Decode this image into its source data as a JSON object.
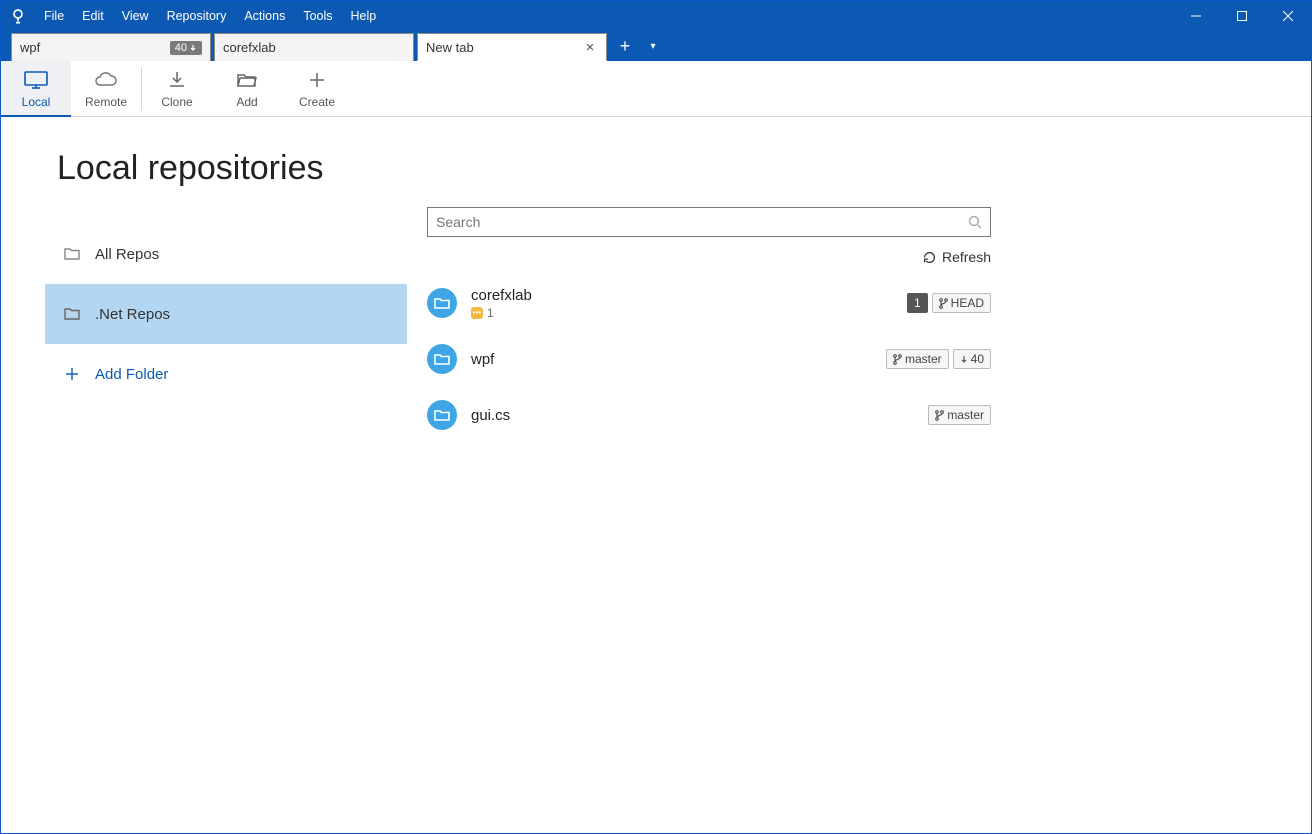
{
  "menu": {
    "items": [
      "File",
      "Edit",
      "View",
      "Repository",
      "Actions",
      "Tools",
      "Help"
    ]
  },
  "tabs": [
    {
      "title": "wpf",
      "badge": "40",
      "active": false,
      "closable": false
    },
    {
      "title": "corefxlab",
      "badge": null,
      "active": false,
      "closable": false
    },
    {
      "title": "New tab",
      "badge": null,
      "active": true,
      "closable": true
    }
  ],
  "toolbar": [
    {
      "label": "Local",
      "icon": "monitor",
      "selected": true
    },
    {
      "label": "Remote",
      "icon": "cloud",
      "selected": false
    },
    {
      "label": "Clone",
      "icon": "download",
      "selected": false
    },
    {
      "label": "Add",
      "icon": "folder-open",
      "selected": false
    },
    {
      "label": "Create",
      "icon": "plus",
      "selected": false
    }
  ],
  "page": {
    "title": "Local repositories"
  },
  "sidebar": {
    "items": [
      {
        "label": "All Repos",
        "icon": "folder",
        "selected": false
      },
      {
        "label": ".Net Repos",
        "icon": "folder",
        "selected": true
      }
    ],
    "add_folder": "Add Folder"
  },
  "search": {
    "placeholder": "Search"
  },
  "refresh": {
    "label": "Refresh"
  },
  "repos": [
    {
      "name": "corefxlab",
      "stash_count": "1",
      "count_badge": "1",
      "branch": "HEAD",
      "incoming": null
    },
    {
      "name": "wpf",
      "stash_count": null,
      "count_badge": null,
      "branch": "master",
      "incoming": "40"
    },
    {
      "name": "gui.cs",
      "stash_count": null,
      "count_badge": null,
      "branch": "master",
      "incoming": null
    }
  ]
}
